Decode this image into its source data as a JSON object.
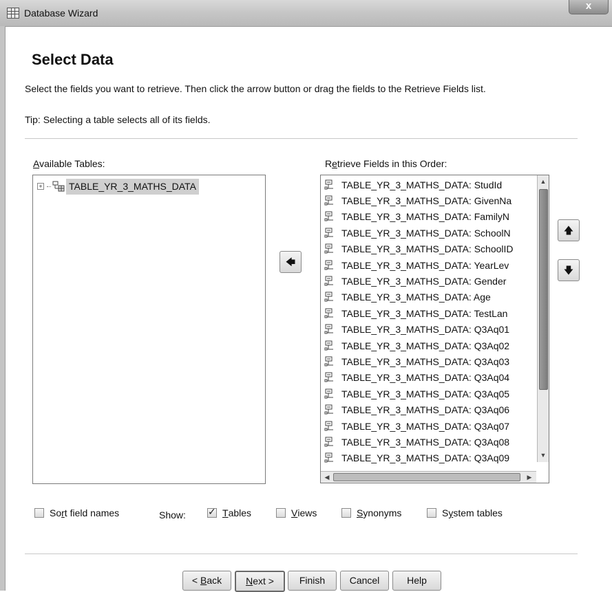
{
  "window": {
    "title": "Database Wizard",
    "close_label": "x"
  },
  "page": {
    "title": "Select Data",
    "instruction": "Select the fields you want to retrieve. Then click the arrow button or drag the fields to the Retrieve Fields list.",
    "tip": "Tip: Selecting a table selects all of its fields."
  },
  "available_tables": {
    "label_u": "A",
    "label_rest": "vailable Tables:",
    "expander": "+",
    "items": [
      {
        "label": "TABLE_YR_3_MATHS_DATA",
        "selected": true
      }
    ]
  },
  "retrieve_fields": {
    "label_pre": "R",
    "label_u": "e",
    "label_rest": "trieve Fields in this Order:",
    "items": [
      "TABLE_YR_3_MATHS_DATA: StudId",
      "TABLE_YR_3_MATHS_DATA: GivenNa",
      "TABLE_YR_3_MATHS_DATA: FamilyN",
      "TABLE_YR_3_MATHS_DATA: SchoolN",
      "TABLE_YR_3_MATHS_DATA: SchoolID",
      "TABLE_YR_3_MATHS_DATA: YearLev",
      "TABLE_YR_3_MATHS_DATA: Gender",
      "TABLE_YR_3_MATHS_DATA: Age",
      "TABLE_YR_3_MATHS_DATA: TestLan",
      "TABLE_YR_3_MATHS_DATA: Q3Aq01",
      "TABLE_YR_3_MATHS_DATA: Q3Aq02",
      "TABLE_YR_3_MATHS_DATA: Q3Aq03",
      "TABLE_YR_3_MATHS_DATA: Q3Aq04",
      "TABLE_YR_3_MATHS_DATA: Q3Aq05",
      "TABLE_YR_3_MATHS_DATA: Q3Aq06",
      "TABLE_YR_3_MATHS_DATA: Q3Aq07",
      "TABLE_YR_3_MATHS_DATA: Q3Aq08",
      "TABLE_YR_3_MATHS_DATA: Q3Aq09"
    ]
  },
  "arrows": {
    "move_left": "🡄",
    "move_up": "🡅",
    "move_down": "🡇"
  },
  "options": {
    "sort_pre": "So",
    "sort_u": "r",
    "sort_rest": "t field names",
    "sort_checked": false,
    "show_label": "Show:",
    "tables_u": "T",
    "tables_rest": "ables",
    "tables_checked": true,
    "views_u": "V",
    "views_rest": "iews",
    "views_checked": false,
    "synonyms_u": "S",
    "synonyms_rest": "ynonyms",
    "synonyms_checked": false,
    "system_pre": "S",
    "system_u": "y",
    "system_rest": "stem tables",
    "system_checked": false
  },
  "buttons": {
    "back_pre": "< ",
    "back_u": "B",
    "back_rest": "ack",
    "next_u": "N",
    "next_rest": "ext >",
    "finish": "Finish",
    "cancel": "Cancel",
    "help": "Help"
  }
}
